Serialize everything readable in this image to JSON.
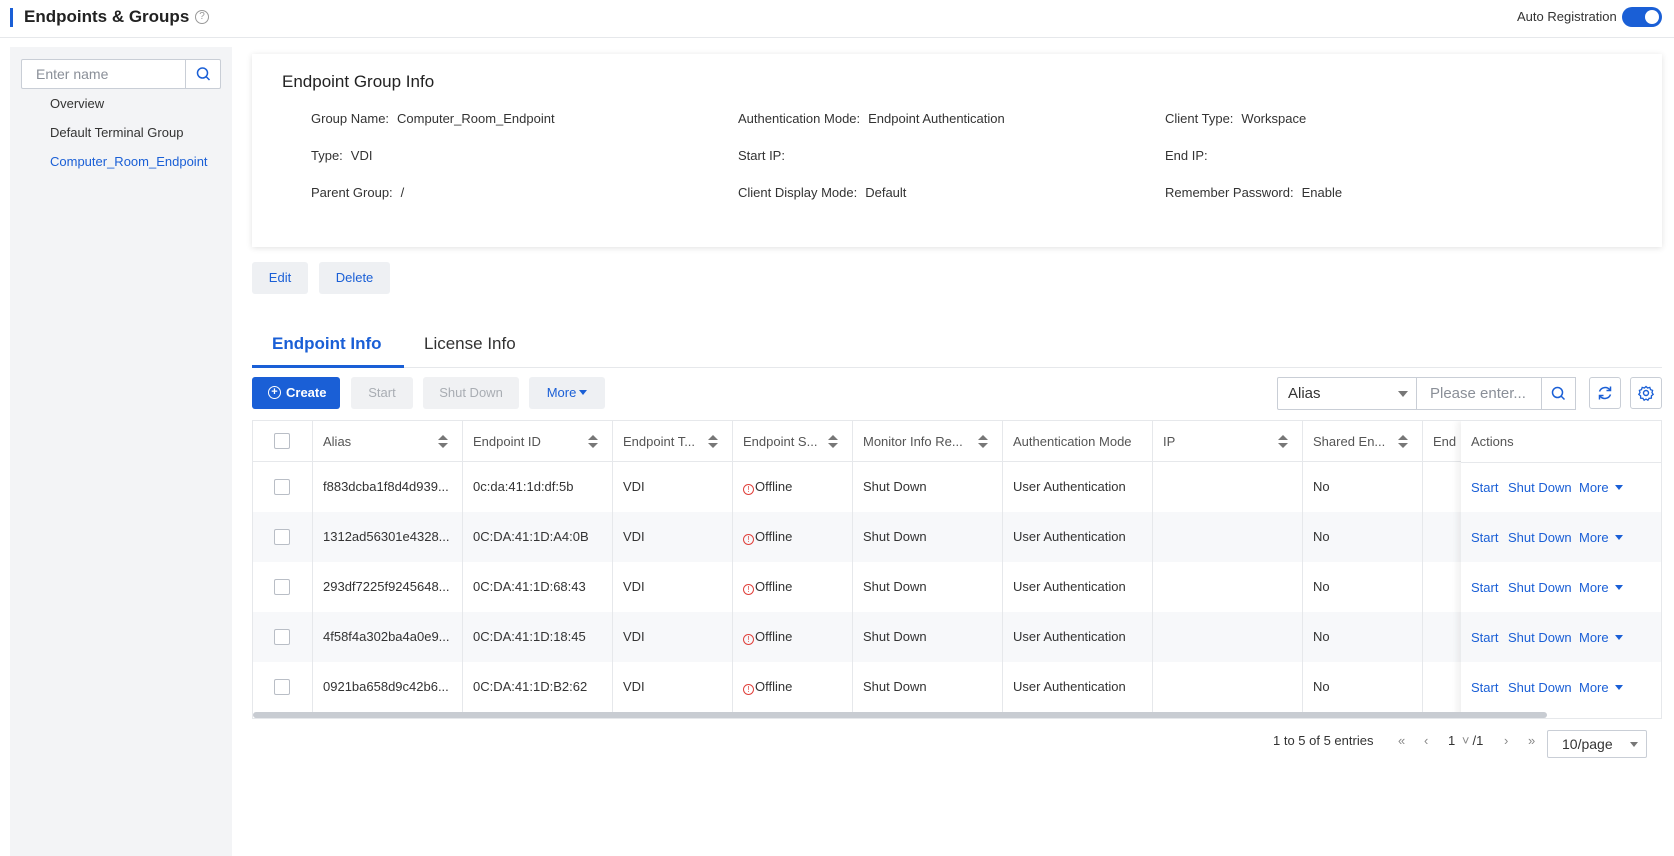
{
  "header": {
    "title": "Endpoints & Groups",
    "auto_registration_label": "Auto Registration",
    "auto_registration_on": true
  },
  "sidebar": {
    "search_placeholder": "Enter name",
    "items": [
      {
        "label": "Overview",
        "active": false
      },
      {
        "label": "Default Terminal Group",
        "active": false
      },
      {
        "label": "Computer_Room_Endpoint",
        "active": true
      }
    ]
  },
  "group_info": {
    "title": "Endpoint Group Info",
    "fields": {
      "group_name": {
        "label": "Group Name:",
        "value": "Computer_Room_Endpoint"
      },
      "auth_mode": {
        "label": "Authentication Mode:",
        "value": "Endpoint Authentication"
      },
      "client_type": {
        "label": "Client Type:",
        "value": "Workspace"
      },
      "type": {
        "label": "Type:",
        "value": "VDI"
      },
      "start_ip": {
        "label": "Start IP:",
        "value": ""
      },
      "end_ip": {
        "label": "End IP:",
        "value": ""
      },
      "parent_group": {
        "label": "Parent Group:",
        "value": "/"
      },
      "client_display_mode": {
        "label": "Client Display Mode:",
        "value": "Default"
      },
      "remember_password": {
        "label": "Remember Password:",
        "value": "Enable"
      }
    }
  },
  "group_actions": {
    "edit": "Edit",
    "delete": "Delete"
  },
  "tabs": [
    {
      "label": "Endpoint Info",
      "active": true
    },
    {
      "label": "License Info",
      "active": false
    }
  ],
  "toolbar": {
    "create": "Create",
    "start": "Start",
    "shut_down": "Shut Down",
    "more": "More",
    "filter_field": "Alias",
    "filter_placeholder": "Please enter..."
  },
  "table": {
    "columns": [
      "Alias",
      "Endpoint ID",
      "Endpoint T...",
      "Endpoint S...",
      "Monitor Info Re...",
      "Authentication Mode",
      "IP",
      "Shared En...",
      "End",
      "Actions"
    ],
    "rows": [
      {
        "alias": "f883dcba1f8d4d939...",
        "endpoint_id": "0c:da:41:1d:df:5b",
        "type": "VDI",
        "status": "Offline",
        "monitor": "Shut Down",
        "auth": "User Authentication",
        "ip": "",
        "shared": "No"
      },
      {
        "alias": "1312ad56301e4328...",
        "endpoint_id": "0C:DA:41:1D:A4:0B",
        "type": "VDI",
        "status": "Offline",
        "monitor": "Shut Down",
        "auth": "User Authentication",
        "ip": "",
        "shared": "No"
      },
      {
        "alias": "293df7225f9245648...",
        "endpoint_id": "0C:DA:41:1D:68:43",
        "type": "VDI",
        "status": "Offline",
        "monitor": "Shut Down",
        "auth": "User Authentication",
        "ip": "",
        "shared": "No"
      },
      {
        "alias": "4f58f4a302ba4a0e9...",
        "endpoint_id": "0C:DA:41:1D:18:45",
        "type": "VDI",
        "status": "Offline",
        "monitor": "Shut Down",
        "auth": "User Authentication",
        "ip": "",
        "shared": "No"
      },
      {
        "alias": "0921ba658d9c42b6...",
        "endpoint_id": "0C:DA:41:1D:B2:62",
        "type": "VDI",
        "status": "Offline",
        "monitor": "Shut Down",
        "auth": "User Authentication",
        "ip": "",
        "shared": "No"
      }
    ],
    "row_actions": {
      "start": "Start",
      "shut_down": "Shut Down",
      "more": "More"
    }
  },
  "pagination": {
    "summary": "1 to 5 of 5 entries",
    "current_page": "1",
    "total_pages": "/1",
    "page_size": "10/page"
  },
  "colors": {
    "accent": "#1a5fd6",
    "offline": "#e0403b"
  }
}
